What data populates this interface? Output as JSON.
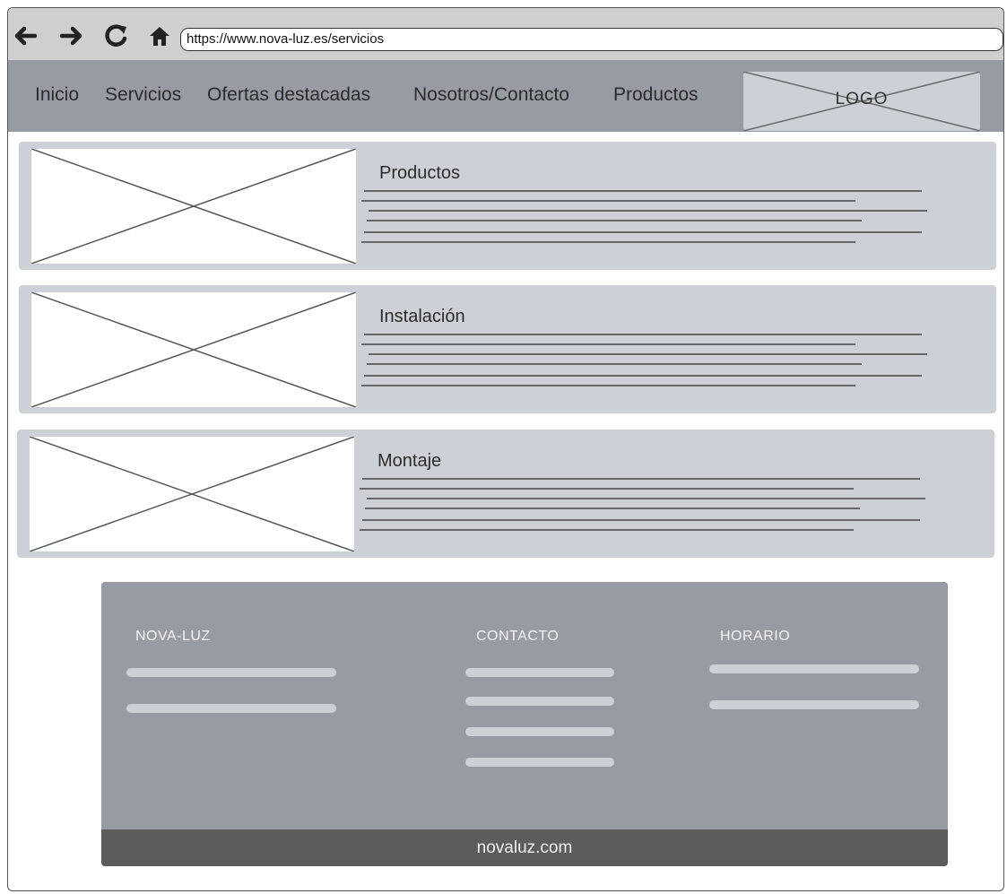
{
  "browser": {
    "url": "https://www.nova-luz.es/servicios",
    "icons": [
      "back-arrow-icon",
      "forward-arrow-icon",
      "reload-icon",
      "home-icon"
    ]
  },
  "nav": {
    "items": [
      "Inicio",
      "Servicios",
      "Ofertas destacadas",
      "Nosotros/Contacto",
      "Productos"
    ],
    "logo": "LOGO"
  },
  "services": [
    {
      "title": "Productos"
    },
    {
      "title": "Instalación"
    },
    {
      "title": "Montaje"
    }
  ],
  "footer": {
    "columns": [
      "NOVA-LUZ",
      "CONTACTO",
      "HORARIO"
    ],
    "domain": "novaluz.com"
  },
  "colors": {
    "nav_bg": "#979ca4",
    "card_bg": "#ccd1d8",
    "footer_bg": "#979ca4",
    "footer_bottom_bg": "#5c5c5c",
    "toolbar_bg": "#d0d0d0"
  }
}
